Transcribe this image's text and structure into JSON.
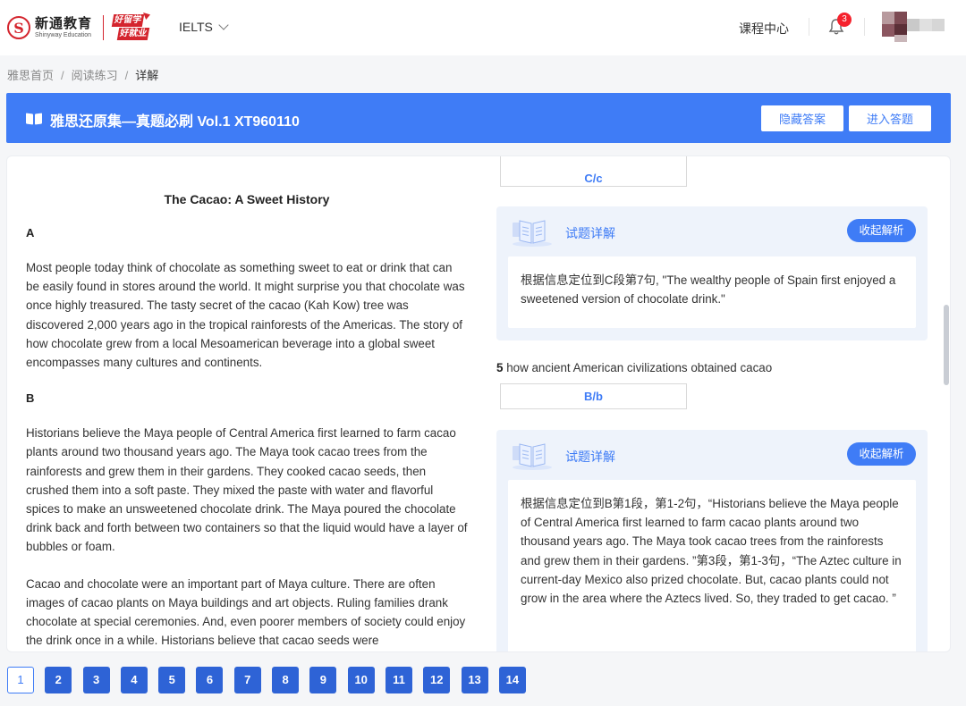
{
  "header": {
    "logo_cn": "新通教育",
    "logo_en": "Shinyway Education",
    "slogan_line1": "好留学",
    "slogan_line2": "好就业",
    "exam_selector": "IELTS",
    "course_center": "课程中心",
    "notification_count": "3"
  },
  "breadcrumb": {
    "items": [
      "雅思首页",
      "阅读练习",
      "详解"
    ]
  },
  "banner": {
    "title": "雅思还原集—真题必刷 Vol.1 XT960110",
    "hide_answers": "隐藏答案",
    "enter_answering": "进入答题"
  },
  "passage": {
    "title": "The Cacao: A Sweet History",
    "sections": [
      {
        "heading": "A",
        "paragraphs": [
          "Most people today think of chocolate as something sweet to eat or drink that can be easily found in stores around the world. It might surprise you that chocolate was once highly treasured. The tasty secret of the cacao (Kah Kow) tree was discovered 2,000 years ago in the tropical rainforests of the Americas. The story of how chocolate grew from a local Mesoamerican beverage into a global sweet encompasses many cultures and continents."
        ]
      },
      {
        "heading": "B",
        "paragraphs": [
          "Historians believe the Maya people of Central America first learned to farm cacao plants around two thousand years ago. The Maya took cacao trees from the rainforests and grew them in their gardens. They cooked cacao seeds, then crushed them into a soft paste. They mixed the paste with water and flavorful spices to make an unsweetened chocolate drink. The Maya poured the chocolate drink back and forth between two containers so that the liquid would have a layer of bubbles or foam.",
          "Cacao and chocolate were an important part of Maya culture. There are often images of cacao plants on Maya buildings and art objects. Ruling families drank chocolate at special ceremonies. And, even poorer members of society could enjoy the drink once in a while. Historians believe that cacao seeds were"
        ]
      }
    ]
  },
  "questions": {
    "top_answer": "C/c",
    "explain_label": "试题详解",
    "collapse_label": "收起解析",
    "explanation_1": "根据信息定位到C段第7句, \"The wealthy people of Spain first enjoyed a sweetened version of chocolate drink.\"",
    "q5_number": "5",
    "q5_text": "how ancient American civilizations obtained cacao",
    "q5_answer": "B/b",
    "explanation_2": "根据信息定位到B第1段，第1-2句，“Historians believe the Maya people of Central America first learned to farm cacao plants around two thousand years ago. The Maya took cacao trees from the rainforests and grew them in their gardens. ”第3段，第1-3句，“The Aztec culture in current-day Mexico also prized chocolate. But, cacao plants could not grow in the area where the Aztecs lived. So, they traded to get cacao. ”"
  },
  "pagination": {
    "pages": [
      "1",
      "2",
      "3",
      "4",
      "5",
      "6",
      "7",
      "8",
      "9",
      "10",
      "11",
      "12",
      "13",
      "14"
    ],
    "active": "1"
  },
  "colors": {
    "primary": "#3f7cf6",
    "brand_red": "#d4252e",
    "badge_red": "#f5222d"
  }
}
